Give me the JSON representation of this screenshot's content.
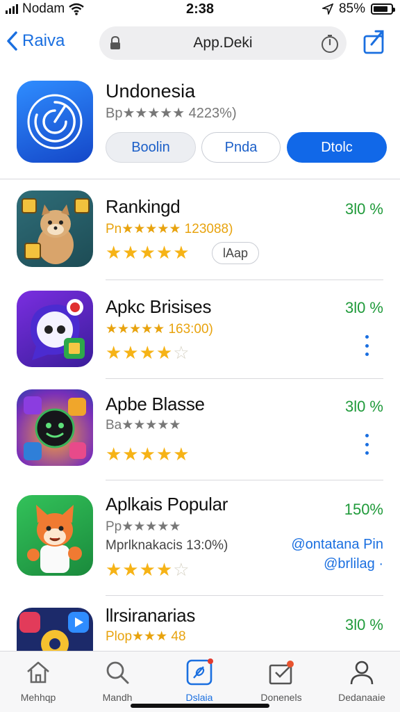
{
  "status_bar": {
    "carrier": "Nodam",
    "time": "2:38",
    "battery": "85%",
    "battery_level": 0.85
  },
  "nav": {
    "back_label": "Raiva",
    "url": "App.Deki"
  },
  "featured": {
    "title": "Undonesia",
    "subtitle": "Bp★★★★★ 4223%)",
    "buttons": [
      "Boolin",
      "Pnda",
      "Dtolc"
    ]
  },
  "apps": [
    {
      "name": "Rankingd",
      "meta": "Pn★★★★★ 123088)",
      "rating": 4.5,
      "percent": "3l0 %",
      "tag": "lAap"
    },
    {
      "name": "Apkc Brisises",
      "meta": "★★★★★ 163:00)",
      "rating": 3.5,
      "percent": "3l0 %"
    },
    {
      "name": "Apbe Blasse",
      "meta": "Ba★★★★★",
      "rating": 4.5,
      "percent": "3l0 %"
    },
    {
      "name": "Aplkais Popular",
      "meta": "Pp★★★★★",
      "meta2": "Mprlknakacis 13:0%)",
      "rating": 3.5,
      "percent": "150%",
      "link": [
        "@ontatana Pin",
        "@brlilag ·"
      ]
    },
    {
      "name": "llrsiranarias",
      "meta": "Plop★★★ 48",
      "percent": "3l0 %"
    }
  ],
  "tabs": [
    {
      "label": "Mehhqp",
      "icon": "home-icon"
    },
    {
      "label": "Mandh",
      "icon": "search-icon"
    },
    {
      "label": "Dslaia",
      "icon": "compass-icon"
    },
    {
      "label": "Donenels",
      "icon": "inbox-icon"
    },
    {
      "label": "Dedanaaie",
      "icon": "person-icon"
    }
  ],
  "colors": {
    "accent": "#1a6fe0",
    "green": "#1f9a3a",
    "star": "#f6b316"
  }
}
